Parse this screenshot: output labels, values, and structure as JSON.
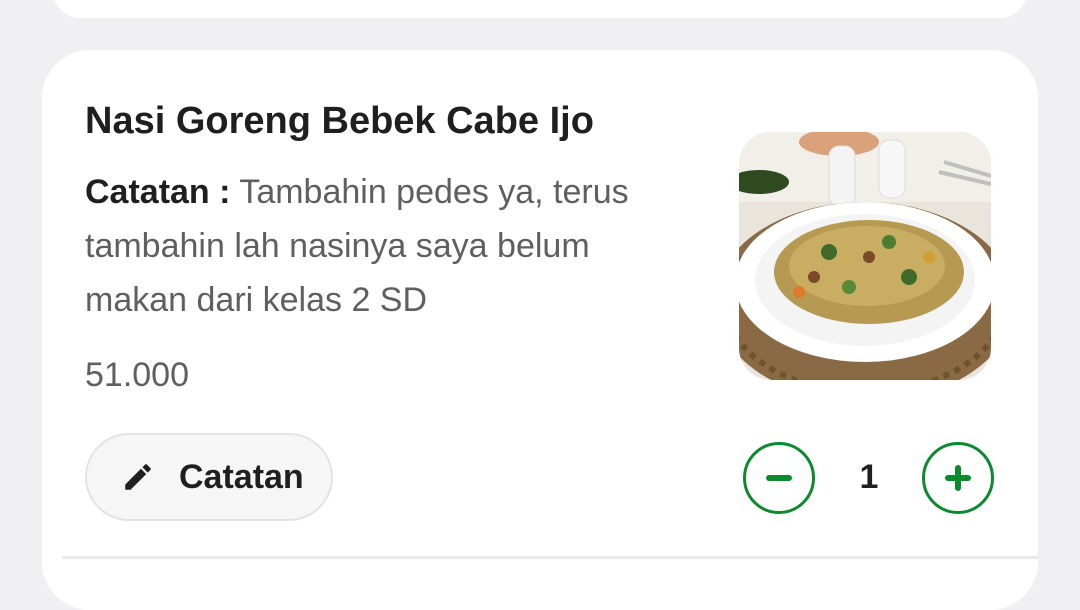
{
  "item": {
    "title": "Nasi Goreng Bebek Cabe Ijo",
    "note_label": "Catatan :",
    "note_text": "Tambahin pedes ya, terus tambahin lah nasinya saya belum makan dari kelas 2 SD",
    "price": "51.000",
    "image": "fried-rice-dish-photo"
  },
  "actions": {
    "note_button_label": "Catatan",
    "note_button_icon": "pencil-icon",
    "decrease_icon": "minus-icon",
    "increase_icon": "plus-icon",
    "quantity": "1"
  },
  "colors": {
    "accent": "#0b8a2e",
    "text_primary": "#1f1f1f",
    "text_secondary": "#5f5f5f",
    "background": "#f0f0f2"
  }
}
